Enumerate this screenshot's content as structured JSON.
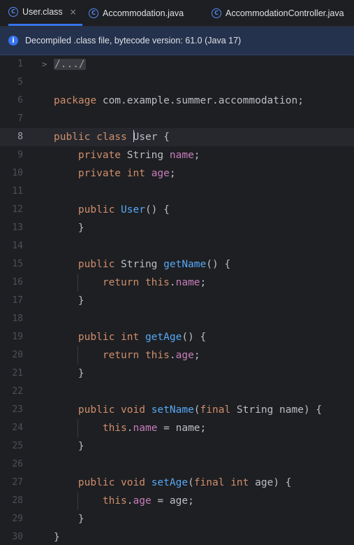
{
  "tabs": [
    {
      "icon": "class-icon",
      "glyph": "C",
      "label": "User.class",
      "active": true,
      "close": "×"
    },
    {
      "icon": "class-icon",
      "glyph": "C",
      "label": "Accommodation.java",
      "active": false
    },
    {
      "icon": "class-icon",
      "glyph": "C",
      "label": "AccommodationController.java",
      "active": false
    }
  ],
  "banner": {
    "icon": "info-icon",
    "glyph": "i",
    "text": "Decompiled .class file, bytecode version: 61.0 (Java 17)"
  },
  "editor": {
    "current_line": 8,
    "fold_marker": ">",
    "lines": [
      {
        "num": "1",
        "tokens": [
          {
            "t": "/.../",
            "c": "collapsed"
          }
        ]
      },
      {
        "num": "5",
        "tokens": []
      },
      {
        "num": "6",
        "tokens": [
          {
            "t": "package ",
            "c": "kw"
          },
          {
            "t": "com.example.summer.accommodation;",
            "c": ""
          }
        ]
      },
      {
        "num": "7",
        "tokens": []
      },
      {
        "num": "8",
        "tokens": [
          {
            "t": "public class ",
            "c": "kw"
          },
          {
            "t": "|",
            "c": "cursor"
          },
          {
            "t": "User",
            "c": ""
          },
          {
            "t": " {",
            "c": ""
          }
        ]
      },
      {
        "num": "9",
        "tokens": [
          {
            "t": "    private ",
            "c": "kw"
          },
          {
            "t": "String ",
            "c": ""
          },
          {
            "t": "name",
            "c": "fld"
          },
          {
            "t": ";",
            "c": ""
          }
        ]
      },
      {
        "num": "10",
        "tokens": [
          {
            "t": "    private int ",
            "c": "kw"
          },
          {
            "t": "age",
            "c": "fld"
          },
          {
            "t": ";",
            "c": ""
          }
        ]
      },
      {
        "num": "11",
        "tokens": []
      },
      {
        "num": "12",
        "tokens": [
          {
            "t": "    public ",
            "c": "kw"
          },
          {
            "t": "User",
            "c": "decl"
          },
          {
            "t": "() {",
            "c": ""
          }
        ]
      },
      {
        "num": "13",
        "tokens": [
          {
            "t": "    }",
            "c": ""
          }
        ]
      },
      {
        "num": "14",
        "tokens": []
      },
      {
        "num": "15",
        "tokens": [
          {
            "t": "    public ",
            "c": "kw"
          },
          {
            "t": "String ",
            "c": ""
          },
          {
            "t": "getName",
            "c": "decl"
          },
          {
            "t": "() {",
            "c": ""
          }
        ]
      },
      {
        "num": "16",
        "tokens": [
          {
            "t": "        return this",
            "c": "kw"
          },
          {
            "t": ".",
            "c": ""
          },
          {
            "t": "name",
            "c": "fld"
          },
          {
            "t": ";",
            "c": ""
          }
        ]
      },
      {
        "num": "17",
        "tokens": [
          {
            "t": "    }",
            "c": ""
          }
        ]
      },
      {
        "num": "18",
        "tokens": []
      },
      {
        "num": "19",
        "tokens": [
          {
            "t": "    public int ",
            "c": "kw"
          },
          {
            "t": "getAge",
            "c": "decl"
          },
          {
            "t": "() {",
            "c": ""
          }
        ]
      },
      {
        "num": "20",
        "tokens": [
          {
            "t": "        return this",
            "c": "kw"
          },
          {
            "t": ".",
            "c": ""
          },
          {
            "t": "age",
            "c": "fld"
          },
          {
            "t": ";",
            "c": ""
          }
        ]
      },
      {
        "num": "21",
        "tokens": [
          {
            "t": "    }",
            "c": ""
          }
        ]
      },
      {
        "num": "22",
        "tokens": []
      },
      {
        "num": "23",
        "tokens": [
          {
            "t": "    public void ",
            "c": "kw"
          },
          {
            "t": "setName",
            "c": "decl"
          },
          {
            "t": "(",
            "c": ""
          },
          {
            "t": "final ",
            "c": "kw"
          },
          {
            "t": "String name) {",
            "c": ""
          }
        ]
      },
      {
        "num": "24",
        "tokens": [
          {
            "t": "        this",
            "c": "kw"
          },
          {
            "t": ".",
            "c": ""
          },
          {
            "t": "name",
            "c": "fld"
          },
          {
            "t": " = name;",
            "c": ""
          }
        ]
      },
      {
        "num": "25",
        "tokens": [
          {
            "t": "    }",
            "c": ""
          }
        ]
      },
      {
        "num": "26",
        "tokens": []
      },
      {
        "num": "27",
        "tokens": [
          {
            "t": "    public void ",
            "c": "kw"
          },
          {
            "t": "setAge",
            "c": "decl"
          },
          {
            "t": "(",
            "c": ""
          },
          {
            "t": "final int ",
            "c": "kw"
          },
          {
            "t": "age) {",
            "c": ""
          }
        ]
      },
      {
        "num": "28",
        "tokens": [
          {
            "t": "        this",
            "c": "kw"
          },
          {
            "t": ".",
            "c": ""
          },
          {
            "t": "age",
            "c": "fld"
          },
          {
            "t": " = age;",
            "c": ""
          }
        ]
      },
      {
        "num": "29",
        "tokens": [
          {
            "t": "    }",
            "c": ""
          }
        ]
      },
      {
        "num": "30",
        "tokens": [
          {
            "t": "}",
            "c": ""
          }
        ]
      }
    ]
  },
  "colors": {
    "background": "#1e1f22",
    "accent": "#3574f0",
    "keyword": "#cf8e6d",
    "field": "#c77dbb",
    "declaration": "#56a8f5",
    "banner_bg": "#25324d"
  }
}
